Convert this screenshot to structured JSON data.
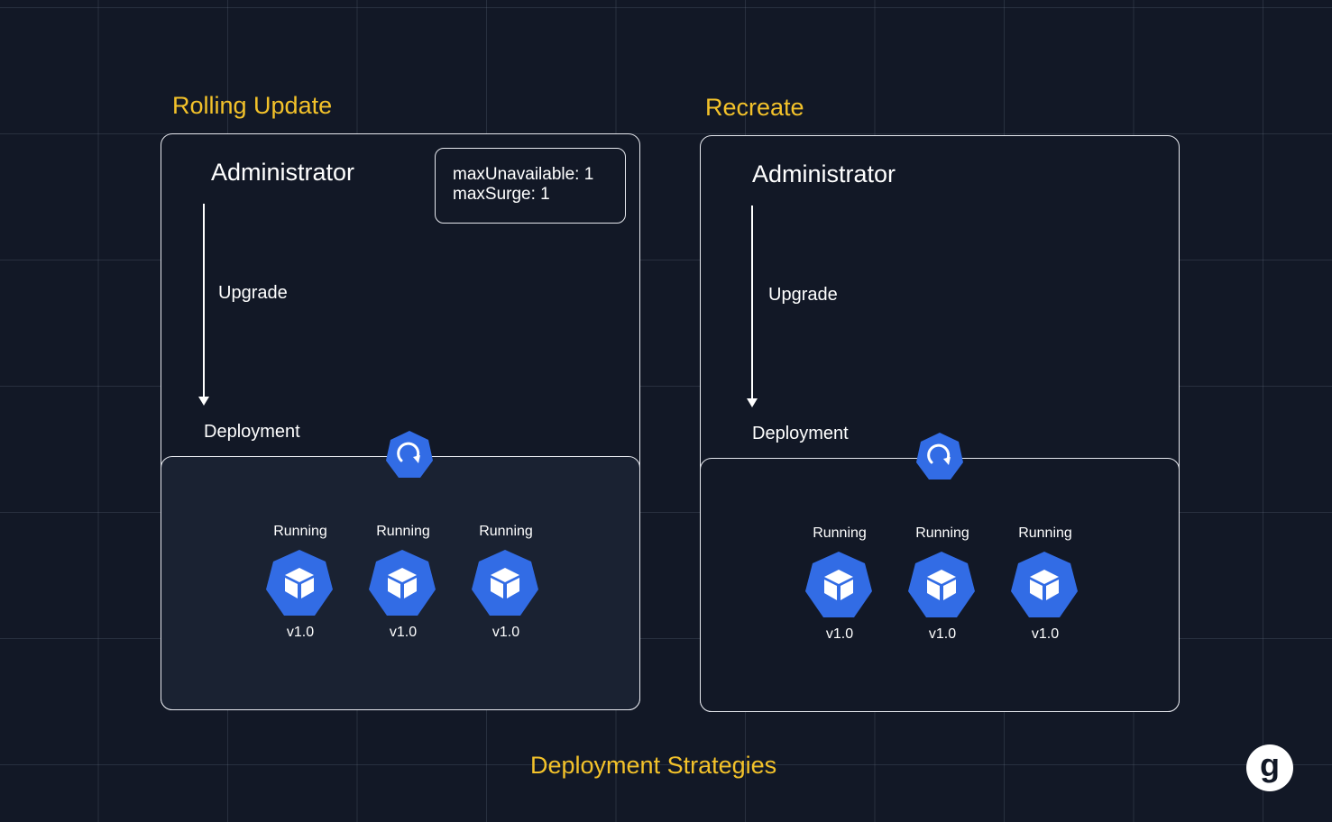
{
  "rolling": {
    "title": "Rolling Update",
    "admin": "Administrator",
    "upgrade": "Upgrade",
    "deployment": "Deployment",
    "config_line1": "maxUnavailable: 1",
    "config_line2": "maxSurge: 1",
    "pods": [
      {
        "status": "Running",
        "version": "v1.0"
      },
      {
        "status": "Running",
        "version": "v1.0"
      },
      {
        "status": "Running",
        "version": "v1.0"
      }
    ]
  },
  "recreate": {
    "title": "Recreate",
    "admin": "Administrator",
    "upgrade": "Upgrade",
    "deployment": "Deployment",
    "pods": [
      {
        "status": "Running",
        "version": "v1.0"
      },
      {
        "status": "Running",
        "version": "v1.0"
      },
      {
        "status": "Running",
        "version": "v1.0"
      }
    ]
  },
  "footer_title": "Deployment Strategies",
  "logo_letter": "g",
  "colors": {
    "background": "#121826",
    "accent_yellow": "#f3c22a",
    "k8s_blue": "#326ce5",
    "lower_panel_fill": "#1a2232"
  },
  "icons": [
    "deployment-icon",
    "pod-cube-icon",
    "brand-logo"
  ]
}
